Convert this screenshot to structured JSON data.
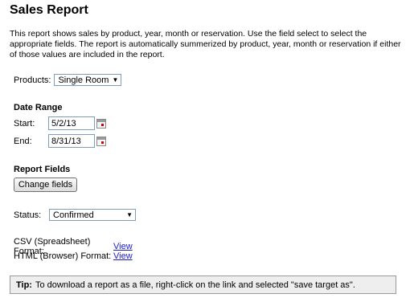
{
  "page": {
    "title": "Sales Report",
    "description": "This report shows sales by product, year, month or reservation. Use the field select to select the appropriate fields. The report is automatically summerized by product, year, month or reservation if either of those values are included in the report."
  },
  "products": {
    "label": "Products:",
    "selected": "Single Room"
  },
  "date_range": {
    "heading": "Date Range",
    "start_label": "Start:",
    "start_value": "5/2/13",
    "end_label": "End:",
    "end_value": "8/31/13"
  },
  "report_fields": {
    "heading": "Report Fields",
    "button_label": "Change fields"
  },
  "status": {
    "label": "Status:",
    "selected": "Confirmed"
  },
  "exports": {
    "csv_label": "CSV (Spreadsheet) Format:",
    "csv_link": "View",
    "html_label": "HTML (Browser) Format:",
    "html_link": "View"
  },
  "tip": {
    "prefix": "Tip:",
    "text": "To download a report as a file, right-click on the link and selected \"save target as\"."
  },
  "icons": {
    "dropdown": "chevron-down-icon",
    "calendar": "calendar-icon"
  }
}
